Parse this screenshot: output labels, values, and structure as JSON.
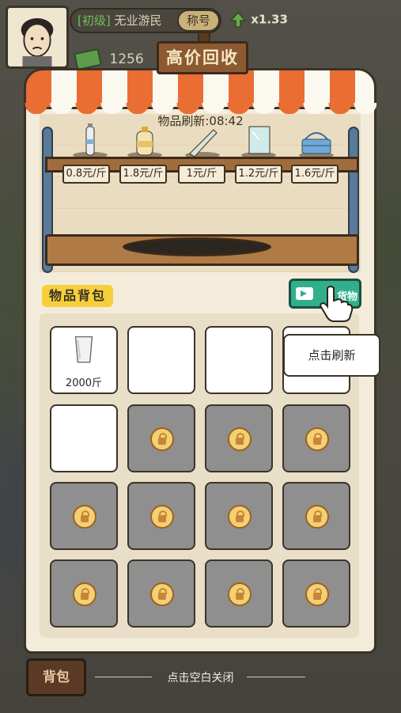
{
  "header": {
    "rank": "[初级]",
    "title": "无业游民",
    "title_button": "称号",
    "multiplier": "x1.33",
    "money": "1256"
  },
  "sign": "高价回收",
  "shop": {
    "refresh_timer": "物品刷新:08:42",
    "items": [
      {
        "icon": "bottle-icon",
        "price": "0.8元/斤"
      },
      {
        "icon": "water-jug-icon",
        "price": "1.8元/斤"
      },
      {
        "icon": "glass-bottle-icon",
        "price": "1元/斤"
      },
      {
        "icon": "glass-pane-icon",
        "price": "1.2元/斤"
      },
      {
        "icon": "basket-icon",
        "price": "1.6元/斤"
      }
    ]
  },
  "backpack": {
    "label": "物品背包",
    "video_button": "货物",
    "tooltip": "点击刷新",
    "slots": [
      {
        "state": "item",
        "icon": "glass-cup-icon",
        "qty": "2000斤"
      },
      {
        "state": "empty"
      },
      {
        "state": "empty"
      },
      {
        "state": "empty"
      },
      {
        "state": "empty"
      },
      {
        "state": "locked"
      },
      {
        "state": "locked"
      },
      {
        "state": "locked"
      },
      {
        "state": "locked"
      },
      {
        "state": "locked"
      },
      {
        "state": "locked"
      },
      {
        "state": "locked"
      },
      {
        "state": "locked"
      },
      {
        "state": "locked"
      },
      {
        "state": "locked"
      },
      {
        "state": "locked"
      }
    ]
  },
  "footer": {
    "bag_button": "背包",
    "close_hint": "点击空白关闭"
  }
}
